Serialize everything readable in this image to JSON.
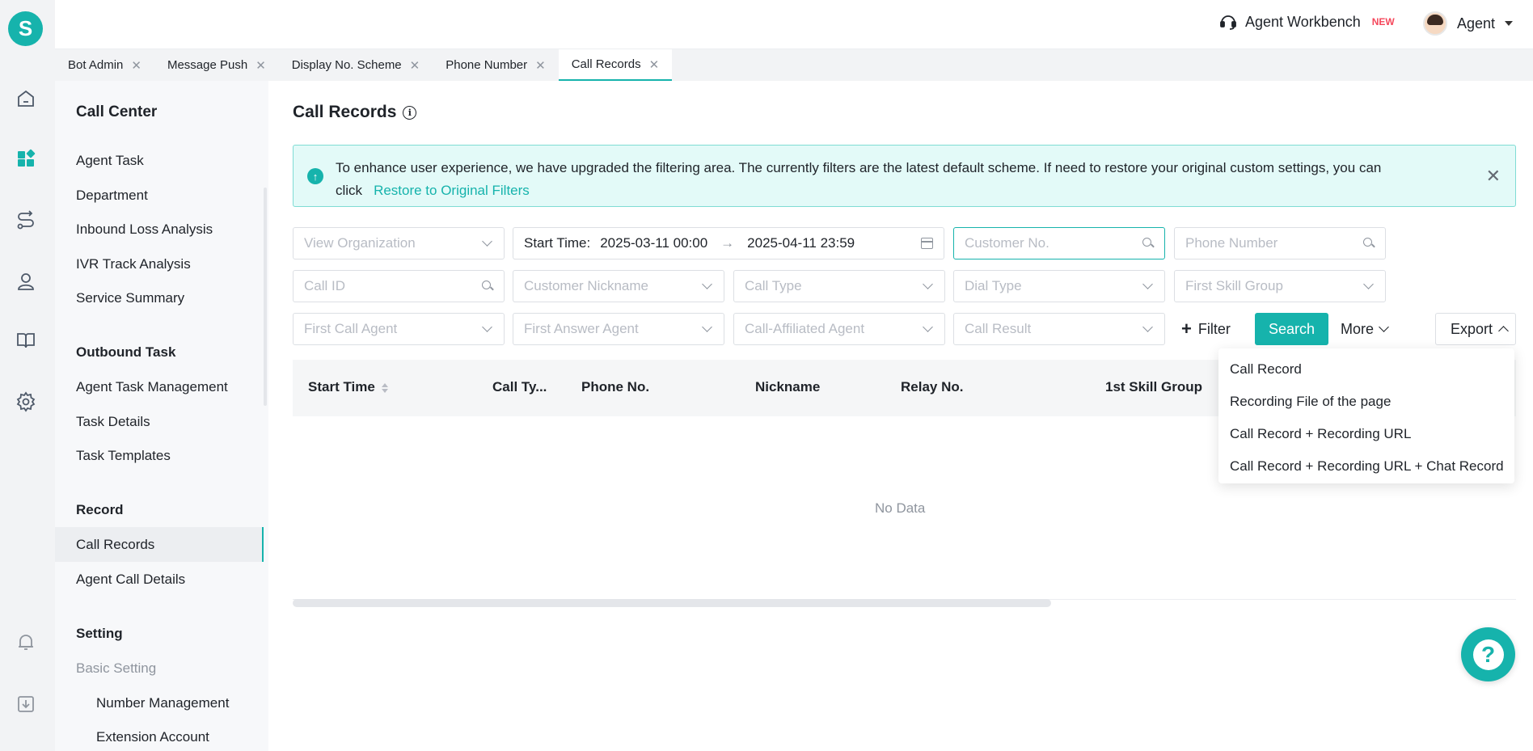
{
  "brand": {
    "logo_letter": "S",
    "accent": "#16b3ac"
  },
  "rail": {
    "icons": [
      "home-icon",
      "apps-icon",
      "route-icon",
      "user-icon",
      "book-icon",
      "gear-icon",
      "bell-icon",
      "download-icon"
    ]
  },
  "topbar": {
    "workbench_label": "Agent Workbench",
    "workbench_badge": "NEW",
    "user_name": "Agent"
  },
  "tabs": [
    {
      "label": "Bot Admin",
      "active": false
    },
    {
      "label": "Message Push",
      "active": false
    },
    {
      "label": "Display No. Scheme",
      "active": false
    },
    {
      "label": "Phone Number",
      "active": false
    },
    {
      "label": "Call Records",
      "active": true
    }
  ],
  "sidenav": {
    "title": "Call Center",
    "sections": [
      {
        "title": "",
        "items": [
          "Agent Task",
          "Department",
          "Inbound Loss Analysis",
          "IVR Track Analysis",
          "Service Summary"
        ]
      },
      {
        "title": "Outbound Task",
        "items": [
          "Agent Task Management",
          "Task Details",
          "Task Templates"
        ]
      },
      {
        "title": "Record",
        "items": [
          "Call Records",
          "Agent Call Details"
        ]
      },
      {
        "title": "Setting",
        "items": [
          "Basic Setting",
          "Number Management",
          "Extension Account"
        ]
      }
    ],
    "active_item": "Call Records"
  },
  "main": {
    "title": "Call Records",
    "notice": {
      "text": "To enhance user experience, we have upgraded the filtering area. The currently filters are the latest default scheme. If need to restore your original custom settings, you can click",
      "link": "Restore to Original Filters"
    },
    "filters": {
      "view_organization": "View Organization",
      "start_time_label": "Start Time",
      "start_time_from": "2025-03-11 00:00",
      "start_time_to": "2025-04-11 23:59",
      "customer_no": "Customer No.",
      "phone_number": "Phone Number",
      "call_id": "Call ID",
      "customer_nickname": "Customer Nickname",
      "call_type": "Call Type",
      "dial_type": "Dial Type",
      "first_skill_group": "First Skill Group",
      "first_call_agent": "First Call Agent",
      "first_answer_agent": "First Answer Agent",
      "call_affiliated_agent": "Call-Affiliated Agent",
      "call_result": "Call Result"
    },
    "actions": {
      "filter": "Filter",
      "search": "Search",
      "more": "More",
      "export": "Export"
    },
    "table": {
      "columns": [
        "Start Time",
        "Call Ty...",
        "Phone No.",
        "Nickname",
        "Relay No.",
        "1st Skill Group"
      ],
      "empty_text": "No Data"
    },
    "export_menu": [
      "Call Record",
      "Recording File of the page",
      "Call Record + Recording URL",
      "Call Record + Recording URL + Chat Record"
    ]
  }
}
